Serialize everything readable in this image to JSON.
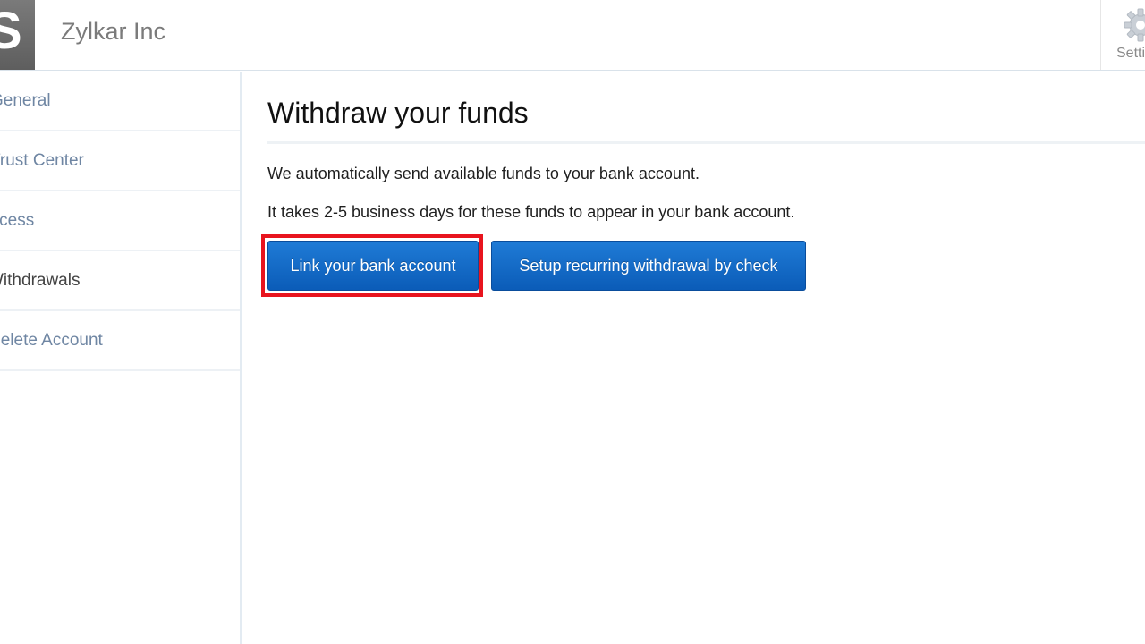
{
  "header": {
    "logo_letter": "S",
    "company_name": "Zylkar Inc",
    "settings_label": "Settings"
  },
  "sidebar": {
    "items": [
      {
        "label": "General",
        "active": false
      },
      {
        "label": "Trust Center",
        "active": false
      },
      {
        "label": "Access",
        "active": false
      },
      {
        "label": "Withdrawals",
        "active": true
      },
      {
        "label": "Delete Account",
        "active": false
      }
    ]
  },
  "main": {
    "title": "Withdraw your funds",
    "paragraph_1": "We automatically send available funds to your bank account.",
    "paragraph_2": "It takes 2-5 business days for these funds to appear in your bank account.",
    "link_bank_label": "Link your bank account",
    "setup_check_label": "Setup recurring withdrawal by check"
  },
  "colors": {
    "button_blue": "#0b5cb8",
    "highlight_red": "#e8141e",
    "sidebar_link": "#6f86a3"
  }
}
